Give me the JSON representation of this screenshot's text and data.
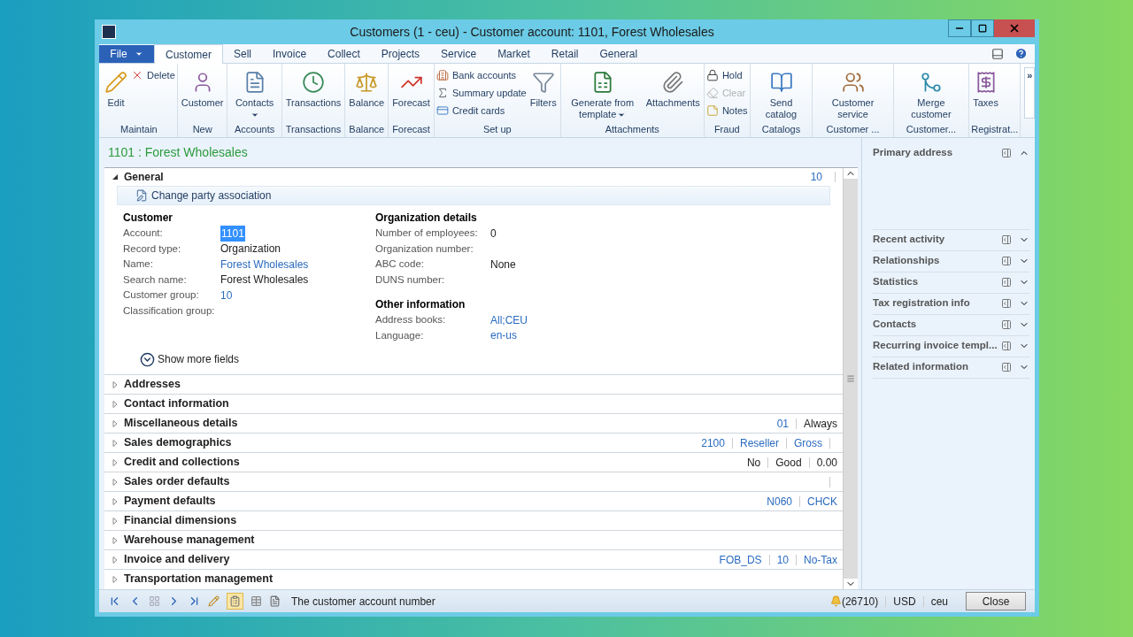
{
  "window": {
    "title": "Customers (1 - ceu) - Customer account: 1101, Forest Wholesales"
  },
  "ribbon": {
    "file_menu": "File",
    "tabs": [
      {
        "label": "Customer",
        "selected": true
      },
      {
        "label": "Sell",
        "selected": false
      },
      {
        "label": "Invoice",
        "selected": false
      },
      {
        "label": "Collect",
        "selected": false
      },
      {
        "label": "Projects",
        "selected": false
      },
      {
        "label": "Service",
        "selected": false
      },
      {
        "label": "Market",
        "selected": false
      },
      {
        "label": "Retail",
        "selected": false
      },
      {
        "label": "General",
        "selected": false
      }
    ],
    "groups": [
      {
        "label": "Maintain",
        "buttons": [
          {
            "kind": "large",
            "label": "Edit",
            "disabled": false,
            "dropdown": false
          },
          {
            "kind": "small",
            "label": "Delete",
            "disabled": false,
            "dropdown": false
          }
        ]
      },
      {
        "label": "New",
        "buttons": [
          {
            "kind": "large",
            "label": "Customer",
            "disabled": false,
            "dropdown": false
          }
        ]
      },
      {
        "label": "Accounts",
        "buttons": [
          {
            "kind": "large",
            "label": "Contacts",
            "disabled": false,
            "dropdown": true
          }
        ]
      },
      {
        "label": "Transactions",
        "buttons": [
          {
            "kind": "large",
            "label": "Transactions",
            "disabled": false,
            "dropdown": false
          }
        ]
      },
      {
        "label": "Balance",
        "buttons": [
          {
            "kind": "large",
            "label": "Balance",
            "disabled": false,
            "dropdown": false
          }
        ]
      },
      {
        "label": "Forecast",
        "buttons": [
          {
            "kind": "large",
            "label": "Forecast",
            "disabled": false,
            "dropdown": false
          }
        ]
      },
      {
        "label": "Set up",
        "buttons": [
          {
            "kind": "small",
            "label": "Bank accounts",
            "disabled": false,
            "dropdown": false
          },
          {
            "kind": "small",
            "label": "Summary update",
            "disabled": false,
            "dropdown": false
          },
          {
            "kind": "small",
            "label": "Credit cards",
            "disabled": false,
            "dropdown": false
          },
          {
            "kind": "large",
            "label": "Filters",
            "disabled": false,
            "dropdown": false
          }
        ]
      },
      {
        "label": "Attachments",
        "buttons": [
          {
            "kind": "large",
            "label": "Generate from template",
            "disabled": false,
            "dropdown": true
          },
          {
            "kind": "large",
            "label": "Attachments",
            "disabled": false,
            "dropdown": false
          }
        ]
      },
      {
        "label": "Fraud",
        "buttons": [
          {
            "kind": "small",
            "label": "Hold",
            "disabled": false,
            "dropdown": false
          },
          {
            "kind": "small",
            "label": "Clear",
            "disabled": true,
            "dropdown": false
          },
          {
            "kind": "small",
            "label": "Notes",
            "disabled": false,
            "dropdown": false
          }
        ]
      },
      {
        "label": "Catalogs",
        "buttons": [
          {
            "kind": "large",
            "label": "Send catalog",
            "disabled": false,
            "dropdown": false
          }
        ]
      },
      {
        "label": "Customer ...",
        "buttons": [
          {
            "kind": "large",
            "label": "Customer service",
            "disabled": false,
            "dropdown": false
          }
        ]
      },
      {
        "label": "Customer...",
        "buttons": [
          {
            "kind": "large",
            "label": "Merge customer",
            "disabled": false,
            "dropdown": false
          }
        ]
      },
      {
        "label": "Registrat...",
        "buttons": [
          {
            "kind": "large",
            "label": "Taxes",
            "disabled": false,
            "dropdown": false
          }
        ]
      }
    ],
    "overflow": "»"
  },
  "form_header": "1101 : Forest Wholesales",
  "general": {
    "title": "General",
    "expanded": true,
    "summary": "10",
    "action": "Change party association",
    "groups": [
      {
        "title": "Customer",
        "fields": [
          {
            "label": "Account:",
            "value": "1101",
            "kind": "selected"
          },
          {
            "label": "Record type:",
            "value": "Organization",
            "kind": "text"
          },
          {
            "label": "Name:",
            "value": "Forest Wholesales",
            "kind": "link"
          },
          {
            "label": "Search name:",
            "value": "Forest Wholesales",
            "kind": "text"
          },
          {
            "label": "Customer group:",
            "value": "10",
            "kind": "link"
          },
          {
            "label": "Classification group:",
            "kind": "empty"
          }
        ]
      },
      {
        "title": "Organization details",
        "fields": [
          {
            "label": "Number of employees:",
            "value": "0",
            "kind": "text"
          },
          {
            "label": "Organization number:",
            "kind": "empty"
          },
          {
            "label": "ABC code:",
            "value": "None",
            "kind": "text"
          },
          {
            "label": "DUNS number:",
            "kind": "empty"
          }
        ]
      },
      {
        "title": "Other information",
        "fields": [
          {
            "label": "Address books:",
            "value": "All;CEU",
            "kind": "link"
          },
          {
            "label": "Language:",
            "value": "en-us",
            "kind": "link"
          }
        ]
      }
    ],
    "more_fields": "Show more fields"
  },
  "fasttabs": [
    {
      "title": "Addresses",
      "expanded": false
    },
    {
      "title": "Contact information",
      "expanded": false
    },
    {
      "title": "Miscellaneous details",
      "expanded": false,
      "summary": [
        {
          "text": "01",
          "link": true
        },
        {
          "text": "Always",
          "link": false
        }
      ]
    },
    {
      "title": "Sales demographics",
      "expanded": false,
      "summary": [
        {
          "text": "2100",
          "link": true
        },
        {
          "text": "Reseller",
          "link": true
        },
        {
          "text": "Gross",
          "link": true
        }
      ],
      "trailing_separator": true
    },
    {
      "title": "Credit and collections",
      "expanded": false,
      "summary": [
        {
          "text": "No",
          "link": false
        },
        {
          "text": "Good",
          "link": false
        },
        {
          "text": "0.00",
          "link": false
        }
      ]
    },
    {
      "title": "Sales order defaults",
      "expanded": false,
      "trailing_separator": true
    },
    {
      "title": "Payment defaults",
      "expanded": false,
      "summary": [
        {
          "text": "N060",
          "link": true
        },
        {
          "text": "CHCK",
          "link": true
        }
      ]
    },
    {
      "title": "Financial dimensions",
      "expanded": false
    },
    {
      "title": "Warehouse management",
      "expanded": false
    },
    {
      "title": "Invoice and delivery",
      "expanded": false,
      "summary": [
        {
          "text": "FOB_DS",
          "link": true
        },
        {
          "text": "10",
          "link": true
        },
        {
          "text": "No-Tax",
          "link": true
        }
      ]
    },
    {
      "title": "Transportation management",
      "expanded": false
    }
  ],
  "factboxes": [
    {
      "title": "Primary address",
      "expanded": true
    },
    {
      "title": "Recent activity",
      "expanded": false
    },
    {
      "title": "Relationships",
      "expanded": false
    },
    {
      "title": "Statistics",
      "expanded": false
    },
    {
      "title": "Tax registration info",
      "expanded": false
    },
    {
      "title": "Contacts",
      "expanded": false
    },
    {
      "title": "Recurring invoice templ...",
      "expanded": false
    },
    {
      "title": "Related information",
      "expanded": false
    }
  ],
  "status_bar": {
    "help_text": "The customer account number",
    "notifications": "(26710)",
    "currency": "USD",
    "company": "ceu",
    "close_button": "Close"
  }
}
